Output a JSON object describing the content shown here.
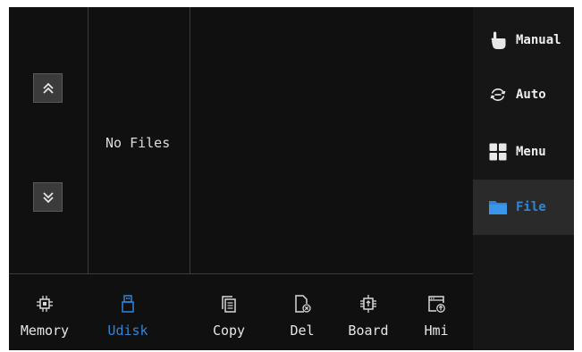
{
  "file_list": {
    "empty_text": "No Files",
    "scroll_up_icon": "double-chevron-up-icon",
    "scroll_down_icon": "double-chevron-down-icon"
  },
  "toolbar": {
    "items": [
      {
        "label": "Memory",
        "icon": "chip-icon",
        "active": false
      },
      {
        "label": "Udisk",
        "icon": "usb-drive-icon",
        "active": true
      },
      {
        "label": "Copy",
        "icon": "copy-icon",
        "active": false
      },
      {
        "label": "Del",
        "icon": "delete-file-icon",
        "active": false
      },
      {
        "label": "Board",
        "icon": "board-chip-icon",
        "active": false
      },
      {
        "label": "Hmi",
        "icon": "hmi-upload-icon",
        "active": false
      }
    ]
  },
  "sidenav": {
    "items": [
      {
        "label": "Manual",
        "icon": "hand-pointer-icon",
        "active": false
      },
      {
        "label": "Auto",
        "icon": "auto-cycle-icon",
        "active": false
      },
      {
        "label": "Menu",
        "icon": "grid-icon",
        "active": false
      },
      {
        "label": "File",
        "icon": "folder-icon",
        "active": true
      }
    ]
  },
  "colors": {
    "background": "#101010",
    "accent": "#2f86d8",
    "text": "#e6e6e6"
  }
}
